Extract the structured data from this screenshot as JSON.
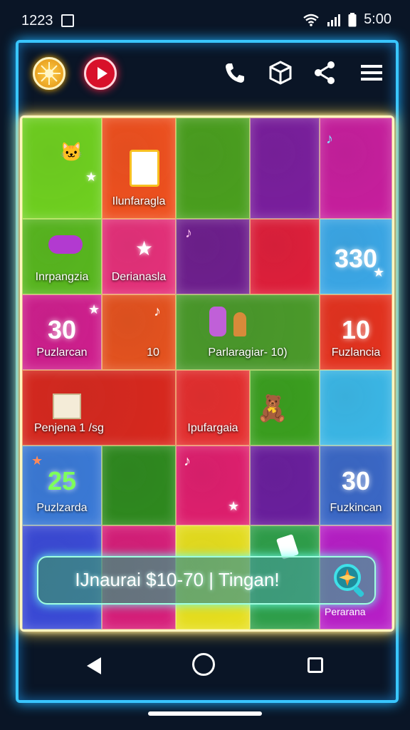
{
  "status": {
    "time": "1223",
    "clock": "5:00"
  },
  "topbar": {
    "icons": [
      "sun-icon",
      "play-icon",
      "phone-icon",
      "cube-icon",
      "share-icon",
      "menu-icon"
    ]
  },
  "board": {
    "rows": [
      [
        {
          "label": "",
          "color": "#6fd11f"
        },
        {
          "label": "Ilunfaragla",
          "color": "#f0501e"
        },
        {
          "label": "",
          "color": "#4aa01e"
        },
        {
          "label": "",
          "color": "#7a1e9e"
        },
        {
          "label": "",
          "color": "#c81e9e"
        }
      ],
      [
        {
          "label": "Inrpangzia",
          "color": "#58b81e"
        },
        {
          "label": "Derianasla",
          "color": "#e6307a"
        },
        {
          "label": "",
          "color": "#6e1e8e"
        },
        {
          "label": "",
          "color": "#e01e3a"
        },
        {
          "label": "",
          "color": "#3aa8e8",
          "num": "330"
        }
      ],
      [
        {
          "label": "Puzlarcan",
          "color": "#d01e8e",
          "num": "30"
        },
        {
          "label": "10",
          "color": "#e6521e"
        },
        {
          "label": "Parlaragiar- 10)",
          "color": "#4a9a2a"
        },
        {
          "label": "Fuzlancia",
          "color": "#e6321e",
          "num": "10"
        }
      ],
      [
        {
          "label": "Penjena 1 /sg",
          "color": "#d8281e"
        },
        {
          "label": "Ipufargaia",
          "color": "#e62e2e"
        },
        {
          "label": "",
          "color": "#3aa01e"
        },
        {
          "label": "",
          "color": "#3ab8e8"
        }
      ],
      [
        {
          "label": "Puzlzarda",
          "color": "#3a7ad8",
          "num": "25"
        },
        {
          "label": "",
          "color": "#2e8a1e"
        },
        {
          "label": "",
          "color": "#e01e6e"
        },
        {
          "label": "",
          "color": "#6a1e9e"
        },
        {
          "label": "Fuzkincan",
          "color": "#3a68c8",
          "num": "30"
        }
      ],
      [
        {
          "label": "",
          "color": "#3a4ad8"
        },
        {
          "label": "",
          "color": "#d81e7a"
        },
        {
          "label": "",
          "color": "#e8e01e"
        },
        {
          "label": "",
          "color": "#2ea04a"
        },
        {
          "label": "",
          "color": "#b81ec8"
        }
      ]
    ]
  },
  "banner": {
    "text": "IJnaurai $10-70 | Tingan!",
    "sub": "Perarana"
  },
  "colors": {
    "frame": "#39c6ff",
    "board_border": "#fff6c0",
    "banner": "#9fffe0"
  }
}
